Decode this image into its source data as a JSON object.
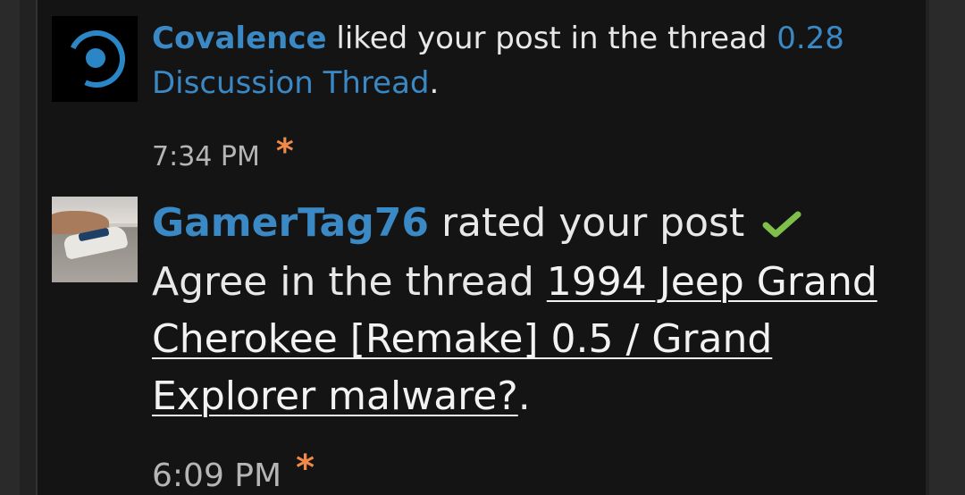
{
  "notifications": [
    {
      "username": "Covalence",
      "action_text": "liked your post in the thread",
      "thread_title": "0.28 Discussion Thread",
      "suffix": ".",
      "time": "7:34 PM"
    },
    {
      "username": "GamerTag76",
      "action_text": "rated your post",
      "rating_icon": "check-icon",
      "rating_text": "Agree in the thread",
      "thread_title": "1994 Jeep Grand Cherokee [Remake] 0.5 / Grand Explorer malware?",
      "suffix": ".",
      "time": "6:09 PM"
    }
  ],
  "colors": {
    "link_blue": "#3a88c4",
    "star_orange": "#f08a4b",
    "check_green": "#7ec04a",
    "background": "#141414"
  },
  "new_marker": "*"
}
